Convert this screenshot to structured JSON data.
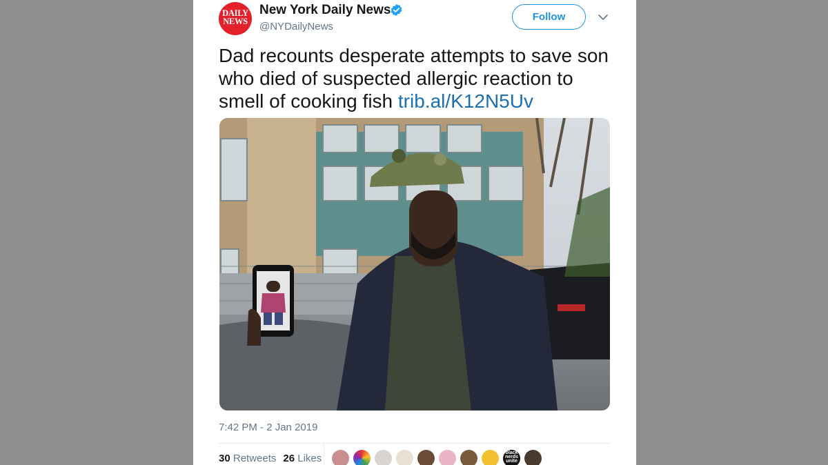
{
  "tweet": {
    "avatar_logo_line1": "DAILY",
    "avatar_logo_line2": "NEWS",
    "display_name": "New York Daily News",
    "handle": "@NYDailyNews",
    "follow_label": "Follow",
    "text": "Dad recounts desperate attempts to save son who died of suspected allergic reaction to smell of cooking fish",
    "link_text": "trib.al/K12N5Uv",
    "timestamp": "7:42 PM - 2 Jan 2019",
    "retweets_count": "30",
    "retweets_label": "Retweets",
    "likes_count": "26",
    "likes_label": "Likes",
    "liker_badge_text": "black nerds unite"
  },
  "icons": {
    "verified": "verified-badge-icon",
    "caret": "chevron-down-icon"
  },
  "colors": {
    "background": "#8f8f8f",
    "card": "#ffffff",
    "brand_red": "#e4202a",
    "link": "#1b6fb3",
    "follow_blue": "#1b95e0",
    "muted": "#657786",
    "text": "#14171a"
  }
}
